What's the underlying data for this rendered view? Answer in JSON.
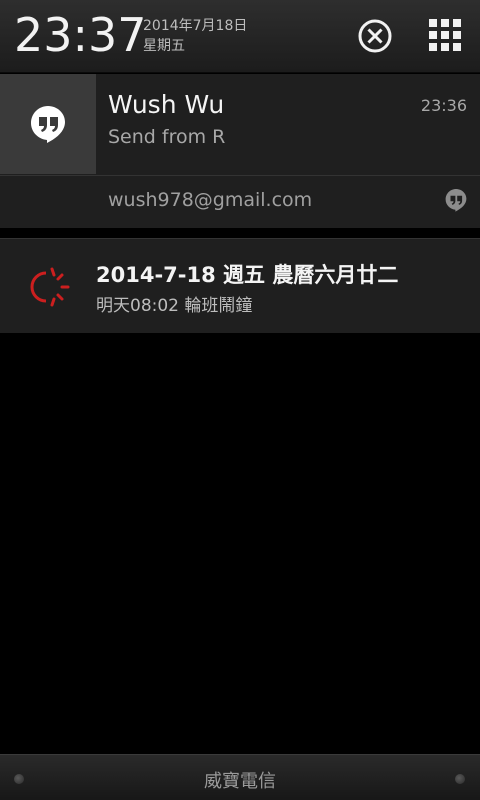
{
  "header": {
    "time": "23:37",
    "date": "2014年7月18日",
    "weekday": "星期五",
    "clear_icon": "clear-all-icon",
    "grid_icon": "quick-settings-grid-icon"
  },
  "notifications": [
    {
      "app_icon": "hangouts-icon",
      "title": "Wush Wu",
      "time": "23:36",
      "text": "Send from R",
      "account": "wush978@gmail.com",
      "small_icon": "hangouts-small-icon"
    },
    {
      "app_icon": "alarm-sun-moon-icon",
      "title": "2014-7-18 週五 農曆六月廿二",
      "text": "明天08:02 輪班鬧鐘",
      "accent_color": "#cc1f1f"
    }
  ],
  "bottom_bar": {
    "carrier": "威寶電信"
  }
}
